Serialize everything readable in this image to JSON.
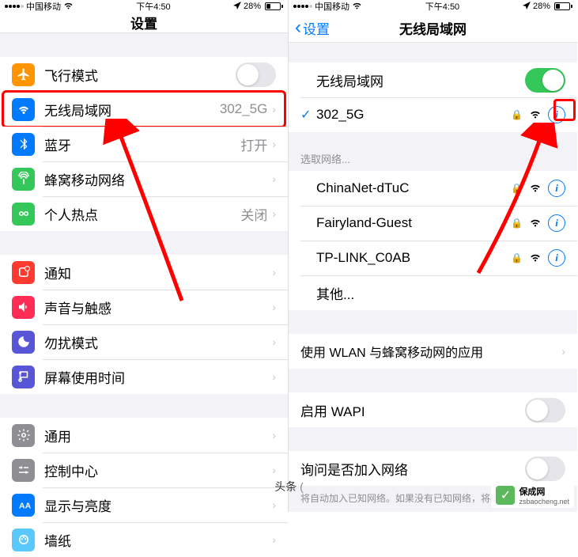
{
  "status": {
    "carrier": "中国移动",
    "time": "下午4:50",
    "battery": "28%"
  },
  "left": {
    "title": "设置",
    "airplane": "飞行模式",
    "wifi": "无线局域网",
    "wifi_value": "302_5G",
    "bluetooth": "蓝牙",
    "bluetooth_value": "打开",
    "cellular": "蜂窝移动网络",
    "hotspot": "个人热点",
    "hotspot_value": "关闭",
    "notifications": "通知",
    "sound": "声音与触感",
    "dnd": "勿扰模式",
    "screentime": "屏幕使用时间",
    "general": "通用",
    "control_center": "控制中心",
    "display": "显示与亮度",
    "wallpaper": "墙纸"
  },
  "right": {
    "back": "设置",
    "title": "无线局域网",
    "wifi_toggle": "无线局域网",
    "connected": "302_5G",
    "choose_network": "选取网络...",
    "networks": [
      "ChinaNet-dTuC",
      "Fairyland-Guest",
      "TP-LINK_C0AB"
    ],
    "other": "其他...",
    "wlan_cellular": "使用 WLAN 与蜂窝移动网的应用",
    "wapi": "启用 WAPI",
    "ask_join": "询问是否加入网络",
    "footer": "将自动加入已知网络。如果没有已知网络，将必须手动选择。"
  },
  "watermark": {
    "name": "保成网",
    "url": "zsbaocheng.net"
  },
  "toutiao": "头条"
}
